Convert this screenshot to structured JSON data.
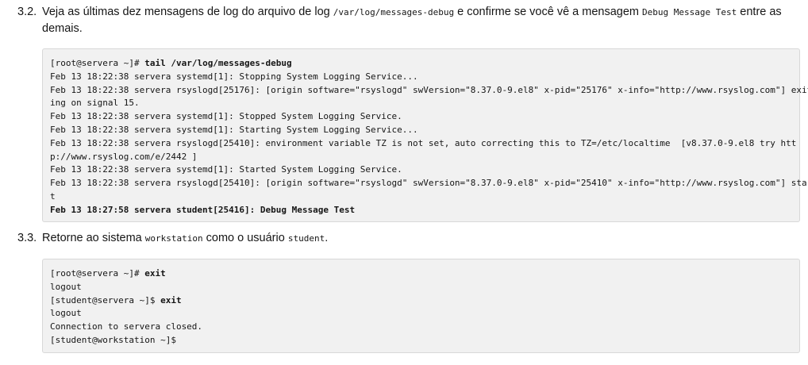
{
  "step_3_2": {
    "number": "3.2.",
    "text_before": "Veja as últimas dez mensagens de log do arquivo de log ",
    "path": "/var/log/messages-debug",
    "text_middle": " e confirme se você vê a mensagem ",
    "message": "Debug Message Test",
    "text_after": " entre as",
    "text_line2": "demais.",
    "code": {
      "prompt": "[root@servera ~]# ",
      "command": "tail /var/log/messages-debug",
      "lines": [
        "Feb 13 18:22:38 servera systemd[1]: Stopping System Logging Service...",
        "Feb 13 18:22:38 servera rsyslogd[25176]: [origin software=\"rsyslogd\" swVersion=\"8.37.0-9.el8\" x-pid=\"25176\" x-info=\"http://www.rsyslog.com\"] exit",
        "ing on signal 15.",
        "Feb 13 18:22:38 servera systemd[1]: Stopped System Logging Service.",
        "Feb 13 18:22:38 servera systemd[1]: Starting System Logging Service...",
        "Feb 13 18:22:38 servera rsyslogd[25410]: environment variable TZ is not set, auto correcting this to TZ=/etc/localtime  [v8.37.0-9.el8 try htt",
        "p://www.rsyslog.com/e/2442 ]",
        "Feb 13 18:22:38 servera systemd[1]: Started System Logging Service.",
        "Feb 13 18:22:38 servera rsyslogd[25410]: [origin software=\"rsyslogd\" swVersion=\"8.37.0-9.el8\" x-pid=\"25410\" x-info=\"http://www.rsyslog.com\"] star",
        "t"
      ],
      "highlight_line": "Feb 13 18:27:58 servera student[25416]: Debug Message Test"
    }
  },
  "step_3_3": {
    "number": "3.3.",
    "text_before": "Retorne ao sistema ",
    "host": "workstation",
    "text_middle": " como o usuário ",
    "user": "student",
    "text_after": ".",
    "code": {
      "line1_prompt": "[root@servera ~]# ",
      "line1_cmd": "exit",
      "line2": "logout",
      "line3_prompt": "[student@servera ~]$ ",
      "line3_cmd": "exit",
      "line4": "logout",
      "line5": "Connection to servera closed.",
      "line6": "[student@workstation ~]$"
    }
  }
}
